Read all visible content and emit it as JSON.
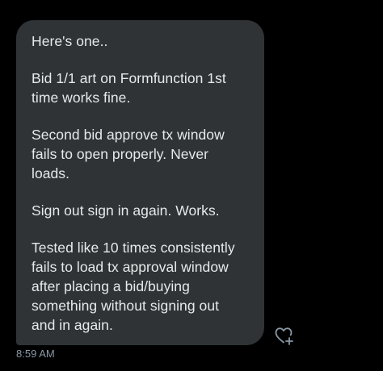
{
  "message": {
    "paragraphs": [
      "Here's one..",
      "Bid 1/1 art on Formfunction 1st\ntime works fine.",
      "Second bid approve tx window\nfails to open properly. Never\nloads.",
      "Sign out sign in again. Works.",
      "Tested like 10 times consistently\nfails to load tx approval window\nafter placing a bid/buying\nsomething without signing out\nand in again."
    ],
    "timestamp": "8:59 AM"
  },
  "icons": {
    "react": "heart-plus-icon"
  },
  "colors": {
    "background": "#000000",
    "bubble": "#2f3336",
    "text": "#e7e9ea",
    "muted": "#8b98a5"
  }
}
